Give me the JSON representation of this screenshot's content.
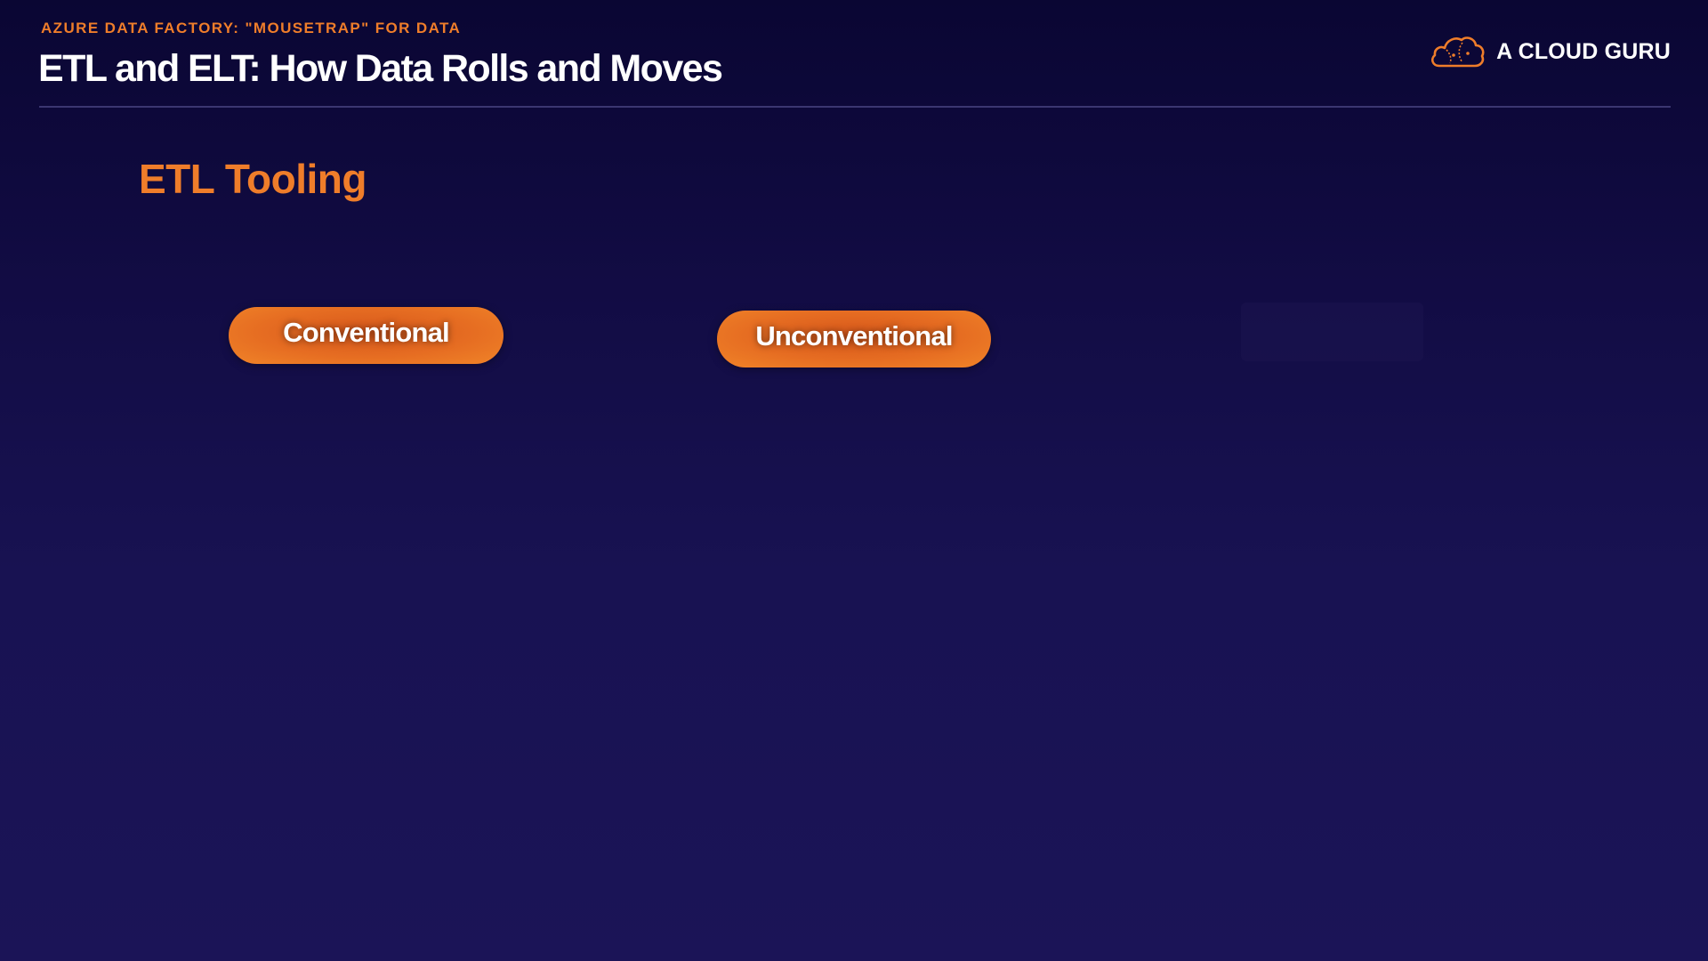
{
  "header": {
    "eyebrow": "AZURE DATA FACTORY: \"MOUSETRAP\" FOR DATA",
    "title": "ETL and ELT: How Data Rolls and Moves"
  },
  "brand": {
    "name": "A CLOUD GURU",
    "icon": "cloud-logo-icon"
  },
  "content": {
    "section_title": "ETL Tooling",
    "categories": [
      {
        "label": "Conventional"
      },
      {
        "label": "Unconventional"
      }
    ]
  },
  "colors": {
    "accent": "#ef7d2a",
    "background_top": "#0a0633",
    "background_bottom": "#1b1457",
    "text_primary": "#ffffff",
    "divider": "#3b3670"
  }
}
